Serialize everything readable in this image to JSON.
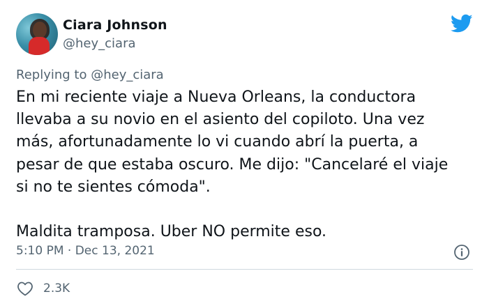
{
  "author": {
    "display_name": "Ciara Johnson",
    "handle": "@hey_ciara"
  },
  "reply": {
    "prefix": "Replying to",
    "mention": "@hey_ciara"
  },
  "tweet": {
    "text": "En mi reciente viaje a Nueva Orleans, la conductora\nllevaba a su novio en el asiento del copiloto. Una vez\nmás, afortunadamente lo vi cuando abrí la puerta, a\npesar de que estaba oscuro. Me dijo: \"Cancelaré el viaje\nsi no te sientes cómoda\".\n\nMaldita tramposa. Uber NO permite eso."
  },
  "meta": {
    "timestamp": "5:10 PM · Dec 13, 2021"
  },
  "engagement": {
    "likes": "2.3K"
  },
  "icons": {
    "brand": "twitter-bird-icon",
    "info": "info-icon",
    "like": "heart-icon"
  },
  "colors": {
    "twitter_blue": "#1d9bf0",
    "secondary_text": "#536471",
    "primary_text": "#0f1419",
    "divider": "#cfd9de"
  }
}
